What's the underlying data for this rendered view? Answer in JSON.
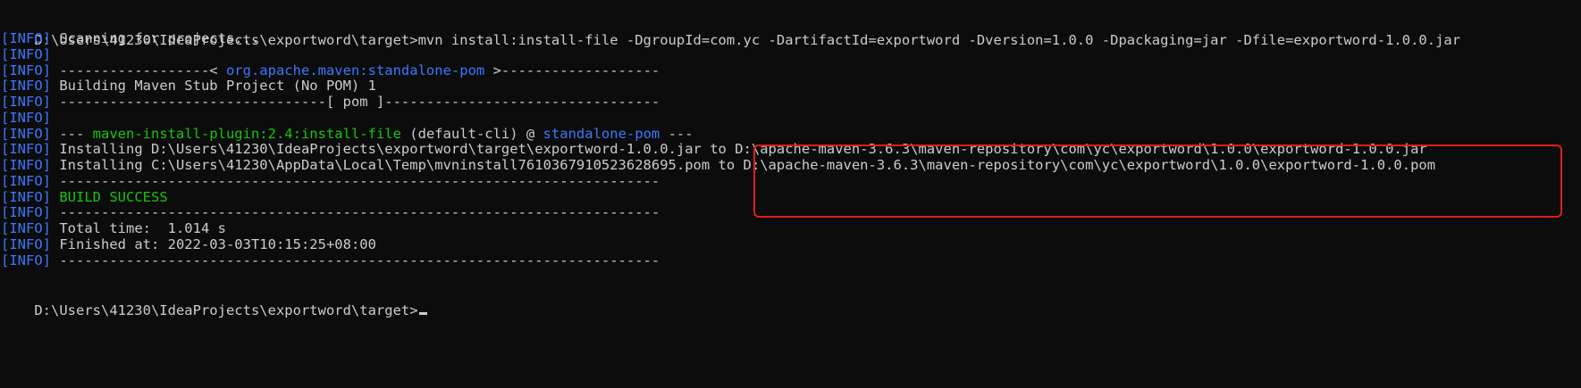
{
  "terminal": {
    "command_line": {
      "prompt": "D:\\Users\\41230\\IdeaProjects\\exportword\\target>",
      "command": "mvn install:install-file -DgroupId=com.yc -DartifactId=exportword -Dversion=1.0.0 -Dpackaging=jar -Dfile=exportword-1.0.0.jar"
    },
    "info_tag": "[INFO]",
    "lines": [
      {
        "tag": true,
        "segments": [
          {
            "text": " Scanning for projects...",
            "style": "text"
          }
        ]
      },
      {
        "tag": true,
        "segments": []
      },
      {
        "tag": true,
        "segments": [
          {
            "text": " ------------------< ",
            "style": "text"
          },
          {
            "text": "org.apache.maven:standalone-pom",
            "style": "link"
          },
          {
            "text": " >-------------------",
            "style": "text"
          }
        ]
      },
      {
        "tag": true,
        "segments": [
          {
            "text": " Building Maven Stub Project (No POM) 1",
            "style": "text"
          }
        ]
      },
      {
        "tag": true,
        "segments": [
          {
            "text": " --------------------------------[ pom ]---------------------------------",
            "style": "text"
          }
        ]
      },
      {
        "tag": true,
        "segments": []
      },
      {
        "tag": true,
        "segments": [
          {
            "text": " --- ",
            "style": "text"
          },
          {
            "text": "maven-install-plugin:2.4:install-file",
            "style": "green"
          },
          {
            "text": " (default-cli) @ ",
            "style": "text"
          },
          {
            "text": "standalone-pom",
            "style": "link"
          },
          {
            "text": " ---",
            "style": "text"
          }
        ]
      },
      {
        "tag": true,
        "segments": [
          {
            "text": " Installing D:\\Users\\41230\\IdeaProjects\\exportword\\target\\exportword-1.0.0.jar to D:\\apache-maven-3.6.3\\maven-repository\\com\\yc\\exportword\\1.0.0\\exportword-1.0.0.jar",
            "style": "text"
          }
        ]
      },
      {
        "tag": true,
        "segments": [
          {
            "text": " Installing C:\\Users\\41230\\AppData\\Local\\Temp\\mvninstall7610367910523628695.pom to D:\\apache-maven-3.6.3\\maven-repository\\com\\yc\\exportword\\1.0.0\\exportword-1.0.0.pom",
            "style": "text"
          }
        ]
      },
      {
        "tag": true,
        "segments": [
          {
            "text": " ------------------------------------------------------------------------",
            "style": "text"
          }
        ]
      },
      {
        "tag": true,
        "segments": [
          {
            "text": " BUILD SUCCESS",
            "style": "green"
          }
        ]
      },
      {
        "tag": true,
        "segments": [
          {
            "text": " ------------------------------------------------------------------------",
            "style": "text"
          }
        ]
      },
      {
        "tag": true,
        "segments": [
          {
            "text": " Total time:  1.014 s",
            "style": "text"
          }
        ]
      },
      {
        "tag": true,
        "segments": [
          {
            "text": " Finished at: 2022-03-03T10:15:25+08:00",
            "style": "text"
          }
        ]
      },
      {
        "tag": true,
        "segments": [
          {
            "text": " ------------------------------------------------------------------------",
            "style": "text"
          }
        ]
      }
    ],
    "final_prompt": "D:\\Users\\41230\\IdeaProjects\\exportword\\target>",
    "colors": {
      "background": "#0c0c0c",
      "text": "#cccccc",
      "info_blue": "#3b78ff",
      "success_green": "#16c60c",
      "highlight_red": "#e01c1c"
    }
  }
}
